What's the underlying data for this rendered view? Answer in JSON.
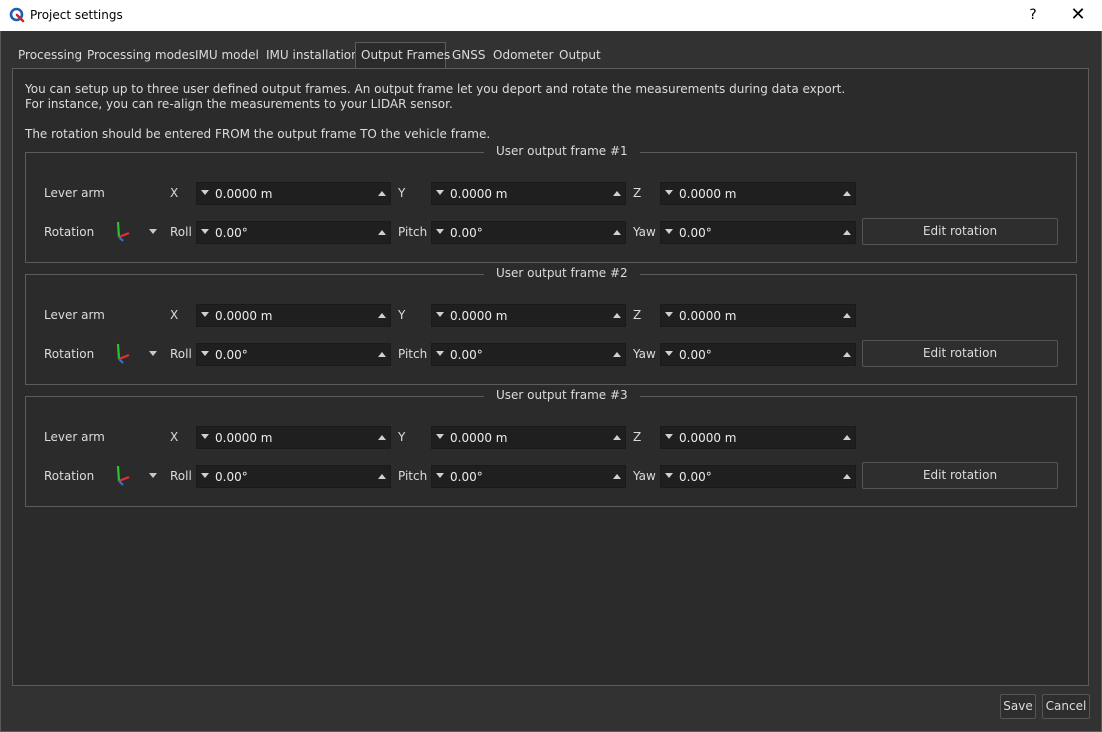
{
  "window": {
    "title": "Project settings",
    "help_label": "?",
    "close_label": "✕"
  },
  "tabs": [
    {
      "label": "Processing"
    },
    {
      "label": "Processing modes"
    },
    {
      "label": "IMU model"
    },
    {
      "label": "IMU installation"
    },
    {
      "label": "Output Frames",
      "active": true
    },
    {
      "label": "GNSS"
    },
    {
      "label": "Odometer"
    },
    {
      "label": "Output"
    }
  ],
  "description": {
    "line1": "You can setup up to three user defined output frames. An output frame let you deport and rotate the measurements during data export.",
    "line2": "For instance, you can re-align the measurements to your LIDAR sensor.",
    "line3": "The rotation should be entered FROM the output frame TO the vehicle frame."
  },
  "labels": {
    "lever_arm": "Lever arm",
    "rotation": "Rotation",
    "x": "X",
    "y": "Y",
    "z": "Z",
    "roll": "Roll",
    "pitch": "Pitch",
    "yaw": "Yaw",
    "edit_rotation": "Edit rotation"
  },
  "frames": [
    {
      "title": "User output frame #1",
      "x": "0.0000 m",
      "y": "0.0000 m",
      "z": "0.0000 m",
      "roll": "0.00°",
      "pitch": "0.00°",
      "yaw": "0.00°"
    },
    {
      "title": "User output frame #2",
      "x": "0.0000 m",
      "y": "0.0000 m",
      "z": "0.0000 m",
      "roll": "0.00°",
      "pitch": "0.00°",
      "yaw": "0.00°"
    },
    {
      "title": "User output frame #3",
      "x": "0.0000 m",
      "y": "0.0000 m",
      "z": "0.0000 m",
      "roll": "0.00°",
      "pitch": "0.00°",
      "yaw": "0.00°"
    }
  ],
  "footer": {
    "save_label": "Save",
    "cancel_label": "Cancel"
  },
  "colors": {
    "background": "#323232",
    "panel": "#2b2b2b",
    "input": "#1f1f1f",
    "axis_x": "#e03030",
    "axis_y": "#30c030",
    "axis_z": "#3070e0"
  }
}
